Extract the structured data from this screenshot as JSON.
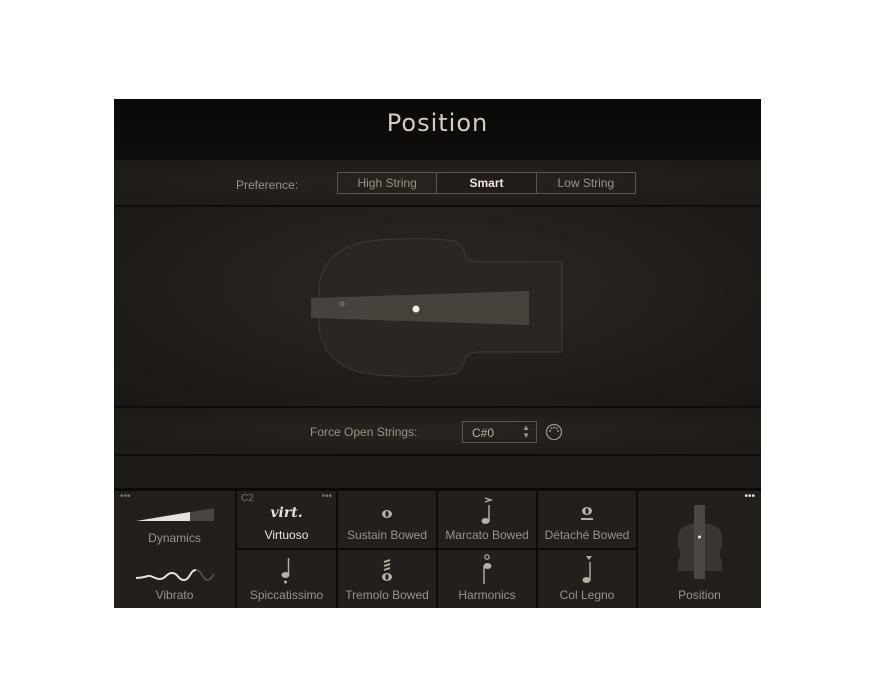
{
  "header": {
    "title": "Position"
  },
  "preference": {
    "label": "Preference:",
    "options": [
      {
        "label": "High String",
        "active": false
      },
      {
        "label": "Smart",
        "active": true
      },
      {
        "label": "Low String",
        "active": false
      }
    ]
  },
  "force_open_strings": {
    "label": "Force Open Strings:",
    "value": "C#0",
    "midi_learn_icon": "midi-connector-icon"
  },
  "articulations": {
    "dynamics": {
      "label": "Dynamics",
      "icon": "dynamics-wedge-icon"
    },
    "vibrato": {
      "label": "Vibrato",
      "icon": "vibrato-wave-icon"
    },
    "tiles": [
      {
        "key": "C2",
        "label": "Virtuoso",
        "icon_text": "virt.",
        "selected": true
      },
      {
        "label": "Sustain Bowed",
        "icon": "whole-note-icon"
      },
      {
        "label": "Marcato Bowed",
        "icon": "marcato-note-icon"
      },
      {
        "label": "Détaché Bowed",
        "icon": "detache-note-icon"
      },
      {
        "label": "Spiccatissimo",
        "icon": "staccato-note-icon"
      },
      {
        "label": "Tremolo Bowed",
        "icon": "tremolo-note-icon"
      },
      {
        "label": "Harmonics",
        "icon": "harmonic-note-icon"
      },
      {
        "label": "Col Legno",
        "icon": "col-legno-note-icon"
      }
    ],
    "position": {
      "label": "Position",
      "icon": "violin-position-icon"
    },
    "more_glyph": "•••"
  }
}
